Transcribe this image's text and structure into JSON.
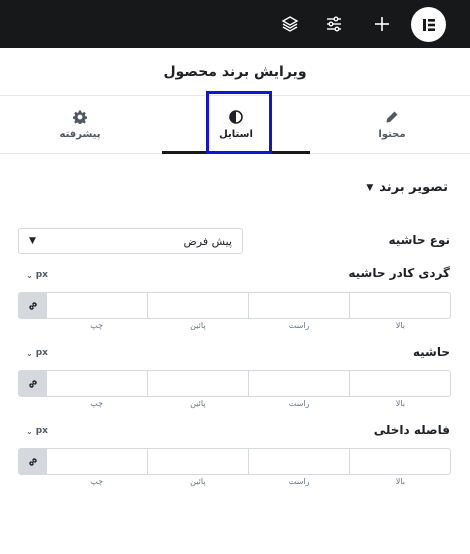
{
  "topbar": {
    "logo_icon": "elementor-logo-icon",
    "add_icon": "plus-icon",
    "settings_icon": "sliders-icon",
    "structure_icon": "layers-icon"
  },
  "panel": {
    "title": "ویرایش برند محصول"
  },
  "tabs": [
    {
      "label": "محتوا",
      "icon": "pencil-icon"
    },
    {
      "label": "استایل",
      "icon": "half-circle-icon",
      "active": true
    },
    {
      "label": "پیشرفته",
      "icon": "gear-icon"
    }
  ],
  "section": {
    "title": "تصویر برند"
  },
  "border_type": {
    "label": "نوع حاشیه",
    "value": "پیش فرض"
  },
  "border_radius": {
    "label": "گردی کادر حاشیه",
    "unit": "px"
  },
  "border_width": {
    "label": "حاشیه",
    "unit": "px"
  },
  "padding": {
    "label": "فاصله داخلی",
    "unit": "px"
  },
  "dimension_labels": {
    "top": "بالا",
    "right": "راست",
    "bottom": "پائین",
    "left": "چپ"
  },
  "colors": {
    "topbar_bg": "#17181a",
    "highlight": "#1414d8"
  }
}
